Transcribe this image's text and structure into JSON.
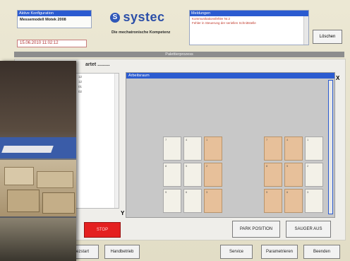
{
  "header": {
    "config_title": "Aktive Konfiguration",
    "config_value": "Messemodell Motek 2008",
    "datetime": "15.06.2010 11:02:12",
    "logo_mark": "S",
    "logo_text": "systec",
    "tagline": "Die mechatronische Kompetenz",
    "messages_title": "Meldungen",
    "messages": [
      "Kommunikationsfehler Nr.2",
      "Fehler in Steuerung der seriellen Schnittstelle"
    ],
    "delete_label": "Löschen"
  },
  "section_title": "Palettierprozess",
  "status_label": "artet .........",
  "list_items": [
    "12",
    "12",
    "01",
    "02"
  ],
  "workspace": {
    "title": "Arbeitsraum",
    "axis_x": "X",
    "axis_y": "Y"
  },
  "pallets": {
    "left": [
      {
        "num": "7",
        "full": false
      },
      {
        "num": "4",
        "full": false
      },
      {
        "num": "1",
        "full": true
      },
      {
        "num": "8",
        "full": false
      },
      {
        "num": "5",
        "full": false
      },
      {
        "num": "2",
        "full": true
      },
      {
        "num": "9",
        "full": false
      },
      {
        "num": "6",
        "full": false
      },
      {
        "num": "3",
        "full": true
      }
    ],
    "right": [
      {
        "num": "7",
        "full": true
      },
      {
        "num": "4",
        "full": true
      },
      {
        "num": "1",
        "full": false
      },
      {
        "num": "8",
        "full": true
      },
      {
        "num": "5",
        "full": true
      },
      {
        "num": "2",
        "full": false
      },
      {
        "num": "9",
        "full": true
      },
      {
        "num": "6",
        "full": true
      },
      {
        "num": "3",
        "full": false
      }
    ]
  },
  "buttons": {
    "stop": "STOP",
    "park": "PARK POSITION",
    "sauger_aus": "SAUGER AUS"
  },
  "toolbar": {
    "neustart": "ezstart",
    "handbetrieb": "Handbetrieb",
    "service": "Service",
    "parametrieren": "Parametrieren",
    "beenden": "Beenden"
  },
  "colors": {
    "accent": "#2b5bd0",
    "slot_full": "#e7c09a",
    "slot_empty": "#f3f1e8",
    "stop": "#e42020"
  }
}
